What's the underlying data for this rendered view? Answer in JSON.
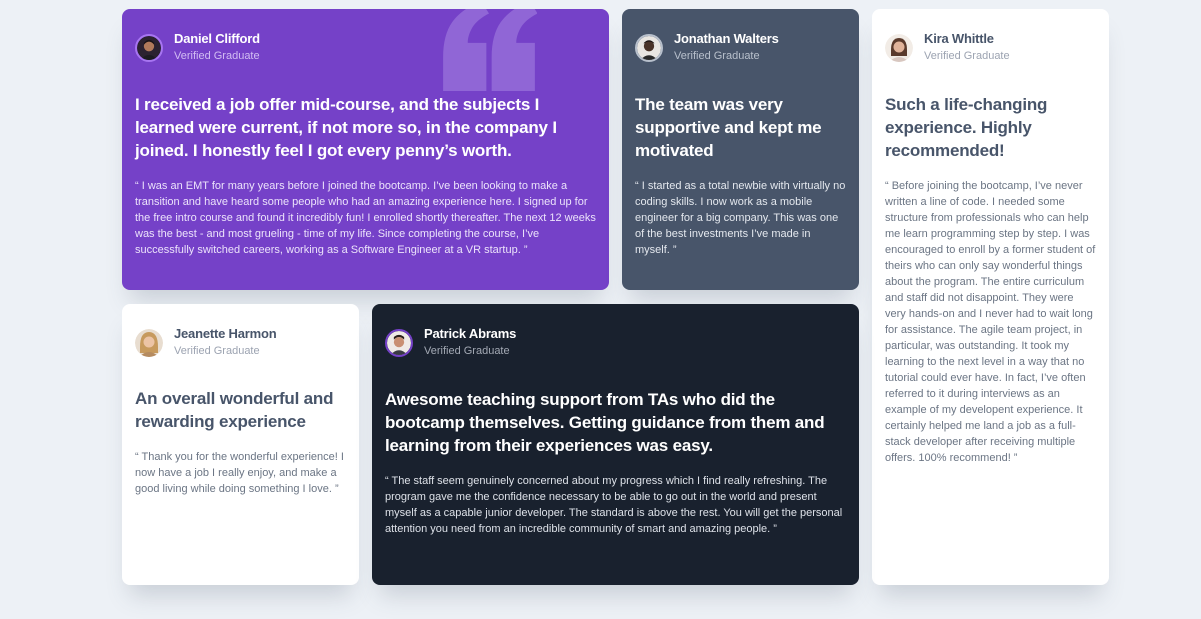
{
  "testimonials": [
    {
      "name": "Daniel Clifford",
      "role": "Verified Graduate",
      "avatar_icon": "user-avatar-daniel",
      "headline": "I received a job offer mid-course, and the subjects I learned were current, if not more so, in the company I joined. I honestly feel I got every penny’s worth.",
      "body": "“ I was an EMT for many years before I joined the bootcamp. I’ve been looking to make a transition and have heard some people who had an amazing experience here. I signed up for the free intro course and found it incredibly fun! I enrolled shortly thereafter. The next 12 weeks was the best - and most grueling - time of my life. Since completing the course, I’ve successfully switched careers, working as a Software Engineer at a VR startup. ”",
      "background": "#7541c8"
    },
    {
      "name": "Jonathan Walters",
      "role": "Verified Graduate",
      "avatar_icon": "user-avatar-jonathan",
      "headline": "The team was very supportive and kept me motivated",
      "body": "“ I started as a total newbie with virtually no coding skills. I now work as a mobile engineer for a big company. This was one of the best investments I’ve made in myself. ”",
      "background": "#48556a"
    },
    {
      "name": "Kira Whittle",
      "role": "Verified Graduate",
      "avatar_icon": "user-avatar-kira",
      "headline": "Such a life-changing experience. Highly recommended!",
      "body": "“ Before joining the bootcamp, I’ve never written a line of code. I needed some structure from professionals who can help me learn programming step by step. I was encouraged to enroll by a former student of theirs who can only say wonderful things about the program. The entire curriculum and staff did not disappoint. They were very hands-on and I never had to wait long for assistance. The agile team project, in particular, was outstanding. It took my learning to the next level in a way that no tutorial could ever have. In fact, I’ve often referred to it during interviews as an example of my developent experience. It certainly helped me land a job as a full-stack developer after receiving multiple offers. 100% recommend! ”",
      "background": "#ffffff"
    },
    {
      "name": "Jeanette Harmon",
      "role": "Verified Graduate",
      "avatar_icon": "user-avatar-jeanette",
      "headline": "An overall wonderful and rewarding experience",
      "body": "“ Thank you for the wonderful experience! I now have a job I really enjoy, and make a good living while doing something I love. ”",
      "background": "#ffffff"
    },
    {
      "name": "Patrick Abrams",
      "role": "Verified Graduate",
      "avatar_icon": "user-avatar-patrick",
      "headline": "Awesome teaching support from TAs who did the bootcamp themselves. Getting guidance from them and learning from their experiences was easy.",
      "body": "“ The staff seem genuinely concerned about my progress which I find really refreshing. The program gave me the confidence necessary to be able to go out in the world and present myself as a capable junior developer. The standard is above the rest. You will get the personal attention you need from an incredible community of smart and amazing people. ”",
      "background": "#19212e"
    }
  ],
  "decor": {
    "quote_icon": "quotation-mark-icon",
    "page_background": "#edf1f6"
  }
}
